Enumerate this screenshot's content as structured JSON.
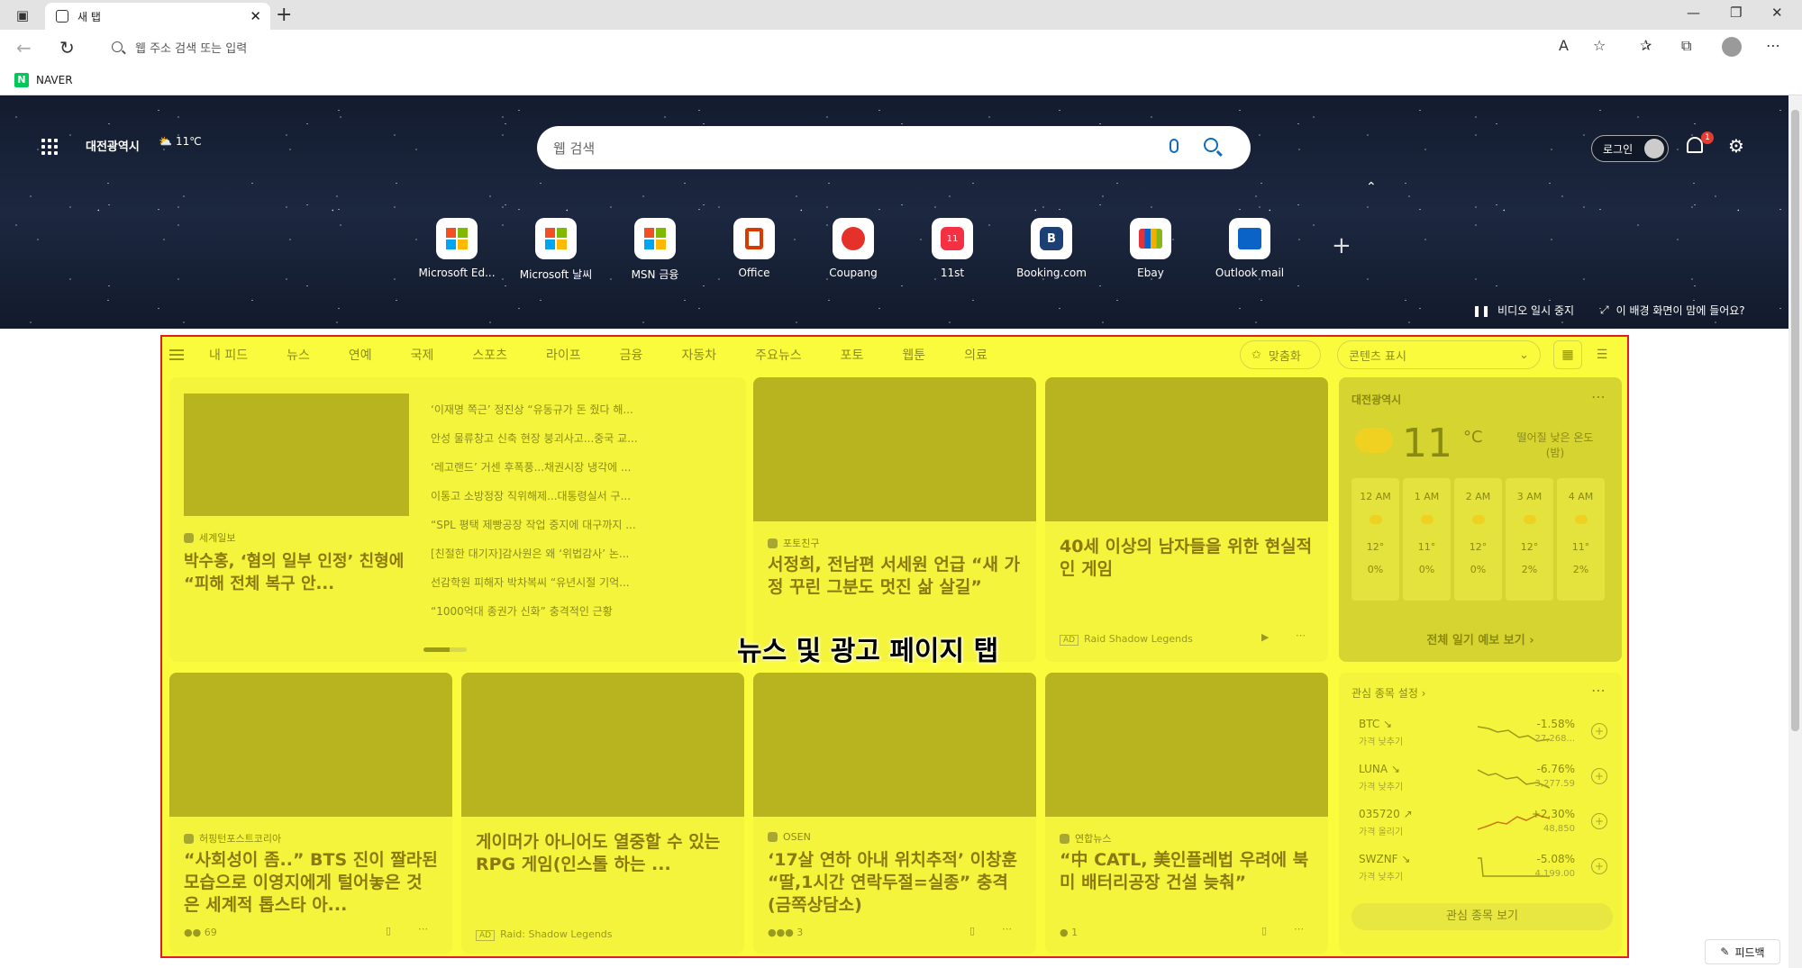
{
  "browser": {
    "tab_title": "새 탭",
    "address_placeholder": "웹 주소 검색 또는 입력",
    "favorites": [
      {
        "label": "NAVER"
      }
    ]
  },
  "hero": {
    "location": "대전광역시",
    "temp_short": "11℃",
    "search_placeholder": "웹 검색",
    "login_label": "로그인",
    "notification_count": "1",
    "quick_links": [
      {
        "label": "Microsoft Ed...",
        "icon": "microsoft-logo-icon"
      },
      {
        "label": "Microsoft 날씨",
        "icon": "microsoft-logo-icon"
      },
      {
        "label": "MSN 금융",
        "icon": "microsoft-logo-icon"
      },
      {
        "label": "Office",
        "icon": "office-icon"
      },
      {
        "label": "Coupang",
        "icon": "coupang-icon"
      },
      {
        "label": "11st",
        "icon": "11st-icon"
      },
      {
        "label": "Booking.com",
        "icon": "booking-icon"
      },
      {
        "label": "Ebay",
        "icon": "ebay-icon"
      },
      {
        "label": "Outlook mail",
        "icon": "outlook-icon"
      }
    ],
    "pause_video": "비디오 일시 중지",
    "like_bg": "이 배경 화면이 맘에 들어요?"
  },
  "feed": {
    "tabs": [
      "내 피드",
      "뉴스",
      "연예",
      "국제",
      "스포츠",
      "라이프",
      "금융",
      "자동차",
      "주요뉴스",
      "포토",
      "웹툰",
      "의료"
    ],
    "personalize": "맞춤화",
    "content_display": "콘텐츠 표시",
    "top_card": {
      "source": "세계일보",
      "title": "박수홍, ‘혐의 일부 인정’ 친형에 “피해 전체 복구 안...",
      "headlines": [
        "‘이재명 쪽근’ 정진상 “유동규가 돈 줬다 해...",
        "안성 물류창고 신축 현장 붕괴사고...중국 교...",
        "‘레고랜드’ 거센 후폭풍...채권시장 냉각에 ...",
        "이통고 소방정장 직위해제...대통령실서 구...",
        "“SPL 평택 제빵공장 작업 중지에 대구까지 ...",
        "[친절한 대기자]감사원은 왜 ‘위법감사’ 논...",
        "선감학원 피해자 박차복씨 “유년시절 기억...",
        "“1000억대 종권가 신화” 충격적인 근황"
      ]
    },
    "card2": {
      "source": "포토친구",
      "title": "서정희, 전남편 서세원 언급 “새 가정 꾸린 그분도 멋진 삶 살길”"
    },
    "card3": {
      "title": "40세 이상의 남자들을 위한 현실적인 게임",
      "ad_source": "Raid Shadow Legends"
    },
    "card4": {
      "source": "허핑턴포스트코리아",
      "title": "“사회성이 좀..” BTS 진이 짤라된 모습으로 이영지에게 털어놓은 것은 세계적 톱스타 아...",
      "reactions": "69"
    },
    "card5": {
      "title": "게이머가 아니어도 열중할 수 있는 RPG 게임(인스톨 하는 ...",
      "ad_source": "Raid: Shadow Legends"
    },
    "card6": {
      "source": "OSEN",
      "title": "‘17살 연하 아내 위치추적’ 이창훈 “딸,1시간 연락두절=실종” 충격(금쪽상담소)",
      "reactions": "3"
    },
    "card7": {
      "source": "연합뉴스",
      "title": "“中 CATL, 美인플레법 우려에 북미 배터리공장 건설 늦춰”",
      "reactions": "1"
    }
  },
  "weather": {
    "city": "대전광역시",
    "temp": "11",
    "unit": "°C",
    "desc": "떨어질 낮은 온도 (밤)",
    "hours": [
      {
        "time": "12 AM",
        "temp": "12°",
        "precip": "0%"
      },
      {
        "time": "1 AM",
        "temp": "11°",
        "precip": "0%"
      },
      {
        "time": "2 AM",
        "temp": "12°",
        "precip": "0%"
      },
      {
        "time": "3 AM",
        "temp": "12°",
        "precip": "2%"
      },
      {
        "time": "4 AM",
        "temp": "11°",
        "precip": "2%"
      }
    ],
    "full_forecast": "전체 일기 예보 보기 ›"
  },
  "watchlist": {
    "header": "관심 종목 설정 ›",
    "items": [
      {
        "symbol": "BTC ↘",
        "sub": "가격 낮추기",
        "pct": "-1.58%",
        "price": "27,268..."
      },
      {
        "symbol": "LUNA ↘",
        "sub": "가격 낮추기",
        "pct": "-6.76%",
        "price": "3,277.59"
      },
      {
        "symbol": "035720 ↗",
        "sub": "가격 올리기",
        "pct": "+2.30%",
        "price": "48,850"
      },
      {
        "symbol": "SWZNF ↘",
        "sub": "가격 낮추기",
        "pct": "-5.08%",
        "price": "4,199.00"
      }
    ],
    "view_button": "관심 종목 보기"
  },
  "overlay_label": "뉴스 및 광고 페이지 탭",
  "feedback_label": "피드백"
}
